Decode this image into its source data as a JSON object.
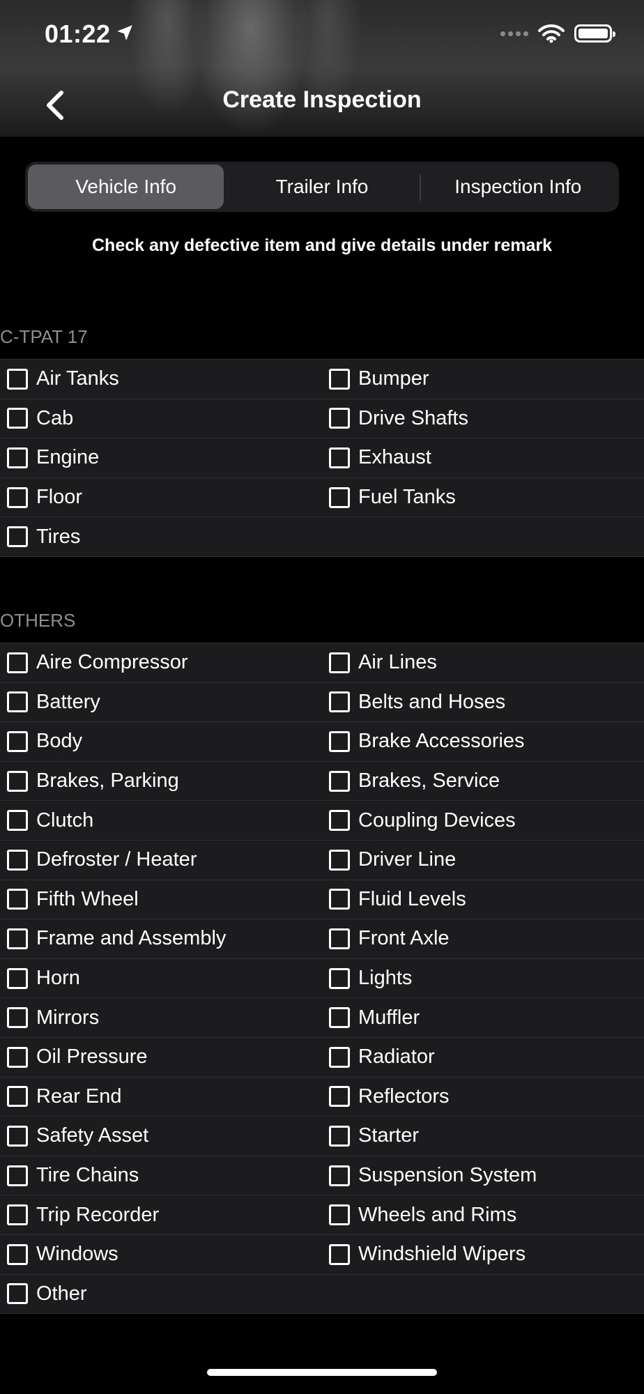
{
  "status_bar": {
    "time": "01:22"
  },
  "nav": {
    "title": "Create Inspection"
  },
  "tabs": [
    {
      "label": "Vehicle Info",
      "active": true
    },
    {
      "label": "Trailer Info",
      "active": false
    },
    {
      "label": "Inspection Info",
      "active": false
    }
  ],
  "instructions": "Check any defective item and give details under remark",
  "sections": [
    {
      "title": "C-TPAT 17",
      "rows": [
        [
          "Air Tanks",
          "Bumper"
        ],
        [
          "Cab",
          "Drive Shafts"
        ],
        [
          "Engine",
          "Exhaust"
        ],
        [
          "Floor",
          "Fuel Tanks"
        ],
        [
          "Tires",
          ""
        ]
      ]
    },
    {
      "title": "OTHERS",
      "rows": [
        [
          "Aire Compressor",
          "Air Lines"
        ],
        [
          "Battery",
          "Belts and Hoses"
        ],
        [
          "Body",
          "Brake Accessories"
        ],
        [
          "Brakes, Parking",
          "Brakes, Service"
        ],
        [
          "Clutch",
          "Coupling Devices"
        ],
        [
          "Defroster / Heater",
          "Driver Line"
        ],
        [
          "Fifth Wheel",
          "Fluid Levels"
        ],
        [
          "Frame and Assembly",
          "Front Axle"
        ],
        [
          "Horn",
          "Lights"
        ],
        [
          "Mirrors",
          "Muffler"
        ],
        [
          "Oil Pressure",
          "Radiator"
        ],
        [
          "Rear End",
          "Reflectors"
        ],
        [
          "Safety Asset",
          "Starter"
        ],
        [
          "Tire Chains",
          "Suspension System"
        ],
        [
          "Trip Recorder",
          "Wheels and Rims"
        ],
        [
          "Windows",
          "Windshield Wipers"
        ],
        [
          "Other",
          ""
        ]
      ]
    }
  ]
}
